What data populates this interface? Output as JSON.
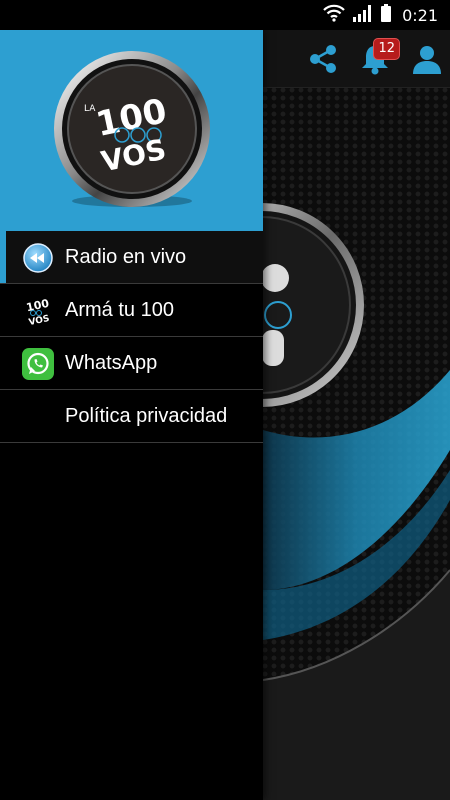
{
  "status_bar": {
    "time": "0:21"
  },
  "toolbar": {
    "notification_count": "12"
  },
  "drawer": {
    "logo": {
      "brand_small": "LA",
      "brand_number": "100",
      "brand_word": "VOS"
    },
    "items": [
      {
        "label": "Radio en vivo",
        "icon": "rewind-icon",
        "active": true
      },
      {
        "label": "Armá tu 100",
        "icon": "logo-icon",
        "active": false
      },
      {
        "label": "WhatsApp",
        "icon": "whatsapp-icon",
        "active": false
      },
      {
        "label": "Política privacidad",
        "icon": "",
        "active": false
      }
    ]
  },
  "colors": {
    "accent": "#2d9fd1",
    "header": "#2d9fd1",
    "badge": "#b71c1c",
    "whatsapp": "#3fbf3f"
  }
}
